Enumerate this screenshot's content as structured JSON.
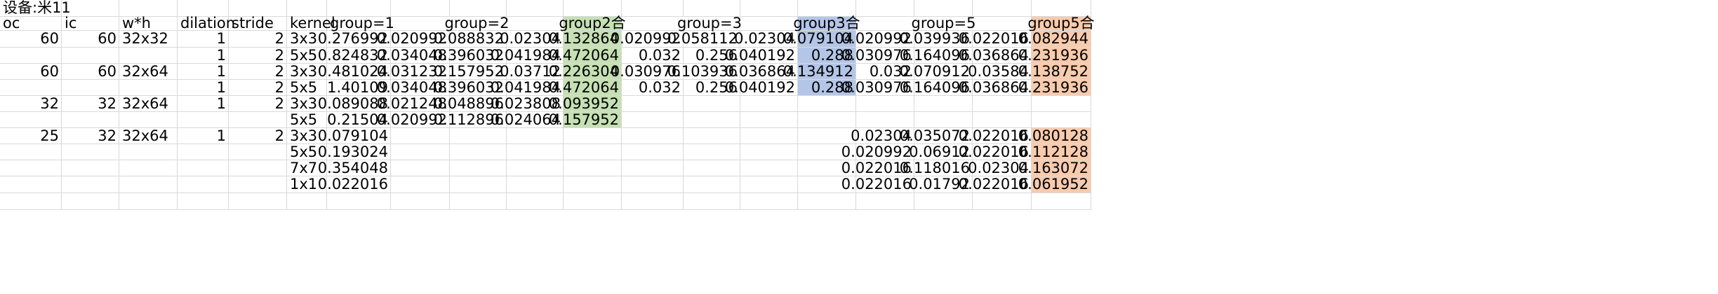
{
  "sheet": {
    "title": "设备:米11",
    "headers": [
      "oc",
      "ic",
      "w*h",
      "dilation",
      "stride",
      "kernel",
      "group=1",
      "group=2",
      "group2合",
      "group=3",
      "group3合",
      "group=5",
      "group5合"
    ],
    "rows": [
      [
        "60",
        "60",
        "32x32",
        "1",
        "2",
        "3x3",
        "0.276992",
        "0.020992",
        "0.088832",
        "0.02304",
        "0.132864",
        "0.020992",
        "0.058112",
        "0.02304",
        "0.079104",
        "0.020992",
        "0.039936",
        "0.022016",
        "0.082944"
      ],
      [
        "",
        "",
        "",
        "1",
        "2",
        "5x5",
        "0.824832",
        "0.034048",
        "0.396032",
        "0.041984",
        "0.472064",
        "0.032",
        "0.256",
        "0.040192",
        "0.288",
        "0.030976",
        "0.164096",
        "0.036864",
        "0.231936"
      ],
      [
        "60",
        "60",
        "32x64",
        "1",
        "2",
        "3x3",
        "0.481024",
        "0.031232",
        "0.157952",
        "0.03712",
        "0.226304",
        "0.030976",
        "0.103936",
        "0.036864",
        "0.134912",
        "0.032",
        "0.070912",
        "0.03584",
        "0.138752"
      ],
      [
        "",
        "",
        "",
        "1",
        "2",
        "5x5",
        "1.40109",
        "0.034048",
        "0.396032",
        "0.041984",
        "0.472064",
        "0.032",
        "0.256",
        "0.040192",
        "0.288",
        "0.030976",
        "0.164096",
        "0.036864",
        "0.231936"
      ],
      [
        "32",
        "32",
        "32x64",
        "1",
        "2",
        "3x3",
        "0.089088",
        "0.021248",
        "0.048896",
        "0.023808",
        "0.093952",
        "",
        "",
        "",
        "",
        "",
        "",
        "",
        ""
      ],
      [
        "",
        "",
        "",
        "",
        "",
        "5x5",
        "0.21504",
        "0.020992",
        "0.112896",
        "0.024064",
        "0.157952",
        "",
        "",
        "",
        "",
        "",
        "",
        "",
        ""
      ],
      [
        "25",
        "32",
        "32x64",
        "1",
        "2",
        "3x3",
        "0.079104",
        "",
        "",
        "",
        "",
        "",
        "",
        "",
        "",
        "0.02304",
        "0.035072",
        "0.022016",
        "0.080128"
      ],
      [
        "",
        "",
        "",
        "",
        "",
        "5x5",
        "0.193024",
        "",
        "",
        "",
        "",
        "",
        "",
        "",
        "",
        "0.020992",
        "0.06912",
        "0.022016",
        "0.112128"
      ],
      [
        "",
        "",
        "",
        "",
        "",
        "7x7",
        "0.354048",
        "",
        "",
        "",
        "",
        "",
        "",
        "",
        "",
        "0.022016",
        "0.118016",
        "0.02304",
        "0.163072"
      ],
      [
        "",
        "",
        "",
        "",
        "",
        "1x1",
        "0.022016",
        "",
        "",
        "",
        "",
        "",
        "",
        "",
        "",
        "0.022016",
        "0.01792",
        "0.022016",
        "0.061952"
      ]
    ]
  },
  "colors": {
    "group2_fill": "#c6e0b4",
    "group3_fill": "#b4c6e7",
    "group5_fill": "#f8cbad",
    "gridline": "#d9d9d9"
  }
}
